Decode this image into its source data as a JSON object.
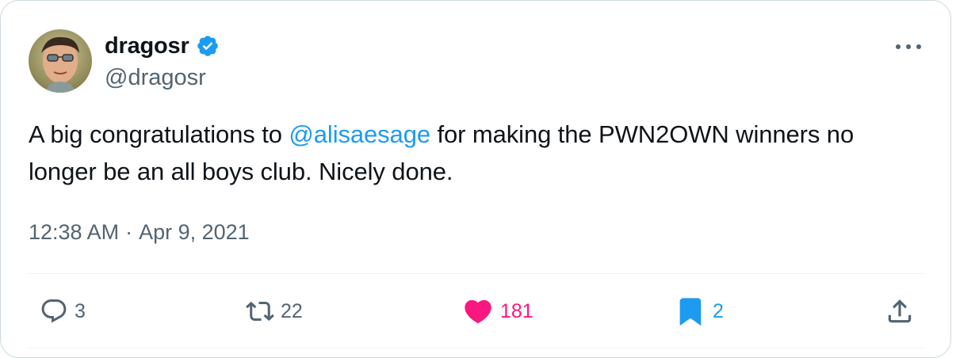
{
  "tweet": {
    "display_name": "dragosr",
    "handle": "@dragosr",
    "text_before": "A big congratulations to ",
    "mention": "@alisaesage",
    "text_after": " for making the PWN2OWN winners no longer be an all boys club. Nicely done.",
    "time": "12:38 AM",
    "separator": "·",
    "date": "Apr 9, 2021"
  },
  "actions": {
    "reply_count": "3",
    "retweet_count": "22",
    "like_count": "181",
    "bookmark_count": "2"
  },
  "colors": {
    "accent": "#1d9bf0",
    "like": "#f91880",
    "muted": "#536471",
    "text": "#0f1419"
  },
  "icons": [
    "verified-badge-icon",
    "more-icon",
    "reply-icon",
    "retweet-icon",
    "heart-icon",
    "bookmark-icon",
    "share-icon"
  ]
}
